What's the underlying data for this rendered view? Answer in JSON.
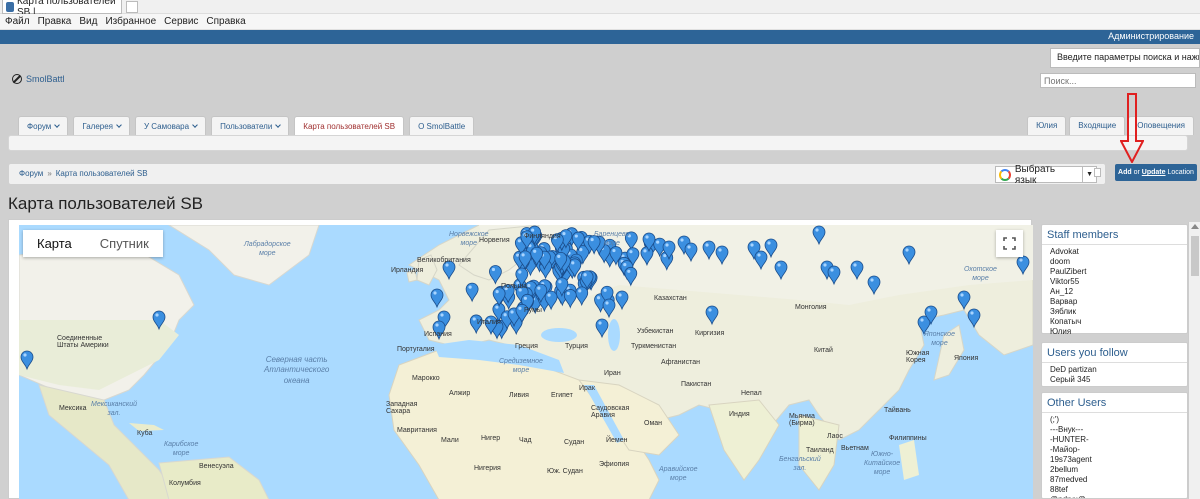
{
  "browser": {
    "tab_title": "Карта пользователей SB | ...",
    "menu": [
      "Файл",
      "Правка",
      "Вид",
      "Избранное",
      "Сервис",
      "Справка"
    ]
  },
  "site": {
    "admin_link": "Администрирование",
    "logo_text": "SmolBattl",
    "search_hint": "Введите параметры поиска и нажмите в",
    "search_placeholder": "Поиск..."
  },
  "nav": {
    "tabs": [
      "Форум",
      "Галерея",
      "У Самовара",
      "Пользователи",
      "Карта пользователей SB",
      "О SmolBattle"
    ],
    "user_tabs": [
      "Юлия",
      "Входящие",
      "Оповещения"
    ]
  },
  "breadcrumb": [
    "Форум",
    "Карта пользователей SB"
  ],
  "translate": {
    "label": "Выбрать язык"
  },
  "location_button": {
    "add": "Add",
    "or": " or ",
    "update": "Update",
    "rest": " Location"
  },
  "page_title": "Карта пользователей SB",
  "map": {
    "type_map": "Карта",
    "type_satellite": "Спутник",
    "labels": {
      "labrador_sea": "Лабрадорское\nморе",
      "norwegian_sea": "Норвежское\nморе",
      "barents_sea": "Баренцево\nморе",
      "okhotsk_sea": "Охотское\nморе",
      "japan_sea": "Японское\nморе",
      "atlantic": "Северная часть\nАтлантического\nокеана",
      "caribbean": "Карибское\nморе",
      "mexican_gulf": "Мексиканский\nзал.",
      "arabian_sea": "Аравийское\nморе",
      "bengal": "Бенгальский\nзал.",
      "south_china": "Южно-\nКитайское\nморе",
      "ireland": "Ирландия",
      "great_britain": "Великобритания",
      "norway": "Норвегия",
      "finland": "Финляндия",
      "poland": "Польша",
      "spain": "Испания",
      "portugal": "Португалия",
      "italy": "Италия",
      "romania": "Румы",
      "greece": "Греция",
      "turkey": "Турция",
      "mediterranean": "Средиземное\nморе",
      "kazakhstan": "Казахстан",
      "uzbekistan": "Узбекистан",
      "kyrgyzstan": "Киргизия",
      "turkmenistan": "Туркменистан",
      "mongolia": "Монголия",
      "china": "Китай",
      "afghanistan": "Афганистан",
      "pakistan": "Пакистан",
      "india": "Индия",
      "nepal": "Непал",
      "myanmar": "Мьянма\n(Бирма)",
      "iran": "Иран",
      "iraq": "Ирак",
      "saudi": "Саудовская\nАравия",
      "oman": "Оман",
      "yemen": "Йемен",
      "morocco": "Марокко",
      "algeria": "Алжир",
      "libya": "Ливия",
      "egypt": "Египет",
      "sudan": "Судан",
      "ethiopia": "Эфиопия",
      "south_sudan": "Юж. Судан",
      "west_sahara": "Западная\nСахара",
      "mauritania": "Мавритания",
      "mali": "Мали",
      "niger": "Нигер",
      "chad": "Чад",
      "nigeria": "Нигерия",
      "usa": "Соединенные\nШтаты Америки",
      "mexico": "Мексика",
      "cuba": "Куба",
      "venezuela": "Венесуэла",
      "colombia": "Колумбия",
      "south_korea": "Южная\nКорея",
      "japan": "Япония",
      "philippines": "Филиппины",
      "thailand": "Таиланд",
      "vietnam": "Вьетнам",
      "taiwan": "Тайвань",
      "laos": "Лаос"
    }
  },
  "sidebar": {
    "staff": {
      "title": "Staff members",
      "members": [
        "Advokat",
        "doom",
        "PaulZibert",
        "Viktor55",
        "Ан_12",
        "Варвар",
        "Зяблик",
        "Копатыч",
        "Юлия"
      ]
    },
    "follow": {
      "title": "Users you follow",
      "members": [
        "DeD partizan",
        "Серый 345"
      ]
    },
    "other": {
      "title": "Other Users",
      "members": [
        "(;')",
        "---Внук---",
        "-HUNTER-",
        "-Майор-",
        "19s73agent",
        "2bellum",
        "87medved",
        "88tef",
        "@ndryx@"
      ]
    }
  }
}
